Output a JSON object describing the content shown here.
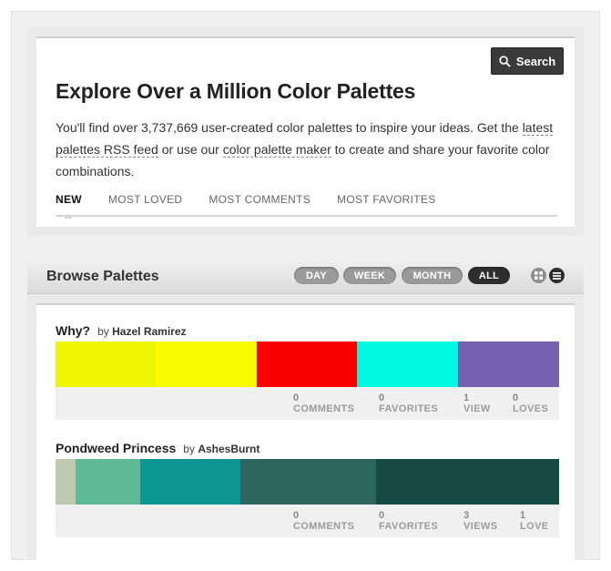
{
  "header": {
    "search_label": "Search",
    "title": "Explore Over a Million Color Palettes",
    "intro_1": "You'll find over 3,737,669 user-created color palettes to inspire your ideas. Get the ",
    "intro_link_rss": "latest palettes RSS feed",
    "intro_2": " or use our ",
    "intro_link_maker": "color palette maker",
    "intro_3": " to create and share your favorite color combinations."
  },
  "tabs": [
    {
      "label": "NEW",
      "active": true
    },
    {
      "label": "MOST LOVED",
      "active": false
    },
    {
      "label": "MOST COMMENTS",
      "active": false
    },
    {
      "label": "MOST FAVORITES",
      "active": false
    }
  ],
  "browse": {
    "title": "Browse Palettes",
    "filters": [
      {
        "label": "DAY",
        "active": false
      },
      {
        "label": "WEEK",
        "active": false
      },
      {
        "label": "MONTH",
        "active": false
      },
      {
        "label": "ALL",
        "active": true
      }
    ],
    "view_icons": [
      "grid-view-icon",
      "list-view-icon"
    ]
  },
  "palettes": [
    {
      "name": "Why?",
      "by": "by",
      "author": "Hazel Ramirez",
      "colors": [
        {
          "hex": "#EEF500",
          "weight": 110
        },
        {
          "hex": "#FAFA00",
          "weight": 110
        },
        {
          "hex": "#FA0000",
          "weight": 110
        },
        {
          "hex": "#00FAE0",
          "weight": 110
        },
        {
          "hex": "#7660B0",
          "weight": 111
        }
      ],
      "stats": [
        {
          "value": "0",
          "label": "COMMENTS"
        },
        {
          "value": "0",
          "label": "FAVORITES"
        },
        {
          "value": "1",
          "label": "VIEW"
        },
        {
          "value": "0",
          "label": "LOVES"
        }
      ]
    },
    {
      "name": "Pondweed Princess",
      "by": "by",
      "author": "AshesBurnt",
      "colors": [
        {
          "hex": "#BDCAB0",
          "weight": 22
        },
        {
          "hex": "#5EBA96",
          "weight": 71
        },
        {
          "hex": "#0B9691",
          "weight": 110
        },
        {
          "hex": "#2E655E",
          "weight": 149
        },
        {
          "hex": "#164B47",
          "weight": 201
        }
      ],
      "stats": [
        {
          "value": "0",
          "label": "COMMENTS"
        },
        {
          "value": "0",
          "label": "FAVORITES"
        },
        {
          "value": "3",
          "label": "VIEWS"
        },
        {
          "value": "1",
          "label": "LOVE"
        }
      ]
    }
  ]
}
